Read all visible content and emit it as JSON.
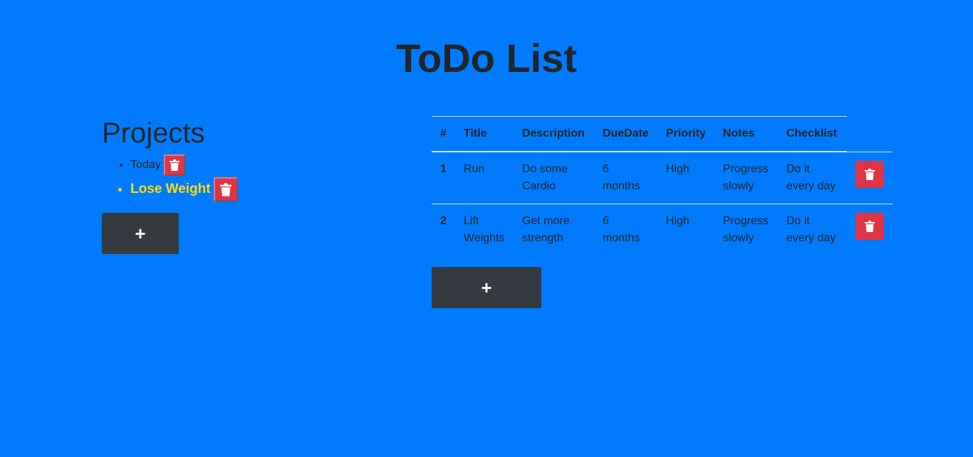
{
  "header": {
    "title": "ToDo List"
  },
  "projects": {
    "heading": "Projects",
    "items": [
      {
        "label": "Today",
        "active": false
      },
      {
        "label": "Lose Weight",
        "active": true
      }
    ],
    "add_label": "+"
  },
  "todos": {
    "columns": [
      "#",
      "Title",
      "Description",
      "DueDate",
      "Priority",
      "Notes",
      "Checklist"
    ],
    "rows": [
      {
        "num": "1",
        "title": "Run",
        "description": "Do some Cardio",
        "due": "6 months",
        "priority": "High",
        "notes": "Progress slowly",
        "checklist": "Do it every day"
      },
      {
        "num": "2",
        "title": "Lift Weights",
        "description": "Get more strength",
        "due": "6 months",
        "priority": "High",
        "notes": "Progress slowly",
        "checklist": "Do it every day"
      }
    ],
    "add_label": "+"
  },
  "colors": {
    "background": "#007bff",
    "danger": "#dc3545",
    "dark": "#343a40",
    "highlight": "#ffdd00"
  },
  "icons": {
    "delete": "trash-icon"
  }
}
